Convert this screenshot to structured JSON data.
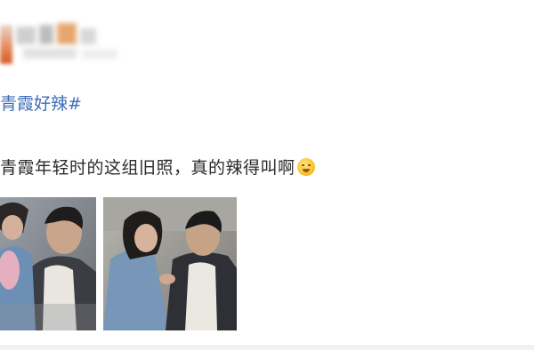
{
  "post": {
    "hashtag": "青霞好辣#",
    "text": "青霞年轻时的这组旧照，真的辣得叫啊",
    "emoji_icon": "crying-laughing-emoji-icon"
  },
  "images": [
    {
      "name": "photo-1",
      "description_icon": "photo-icon"
    },
    {
      "name": "photo-2",
      "description_icon": "photo-icon"
    }
  ],
  "colors": {
    "hashtag": "#3f6eb6",
    "text": "#2b2b2b"
  }
}
